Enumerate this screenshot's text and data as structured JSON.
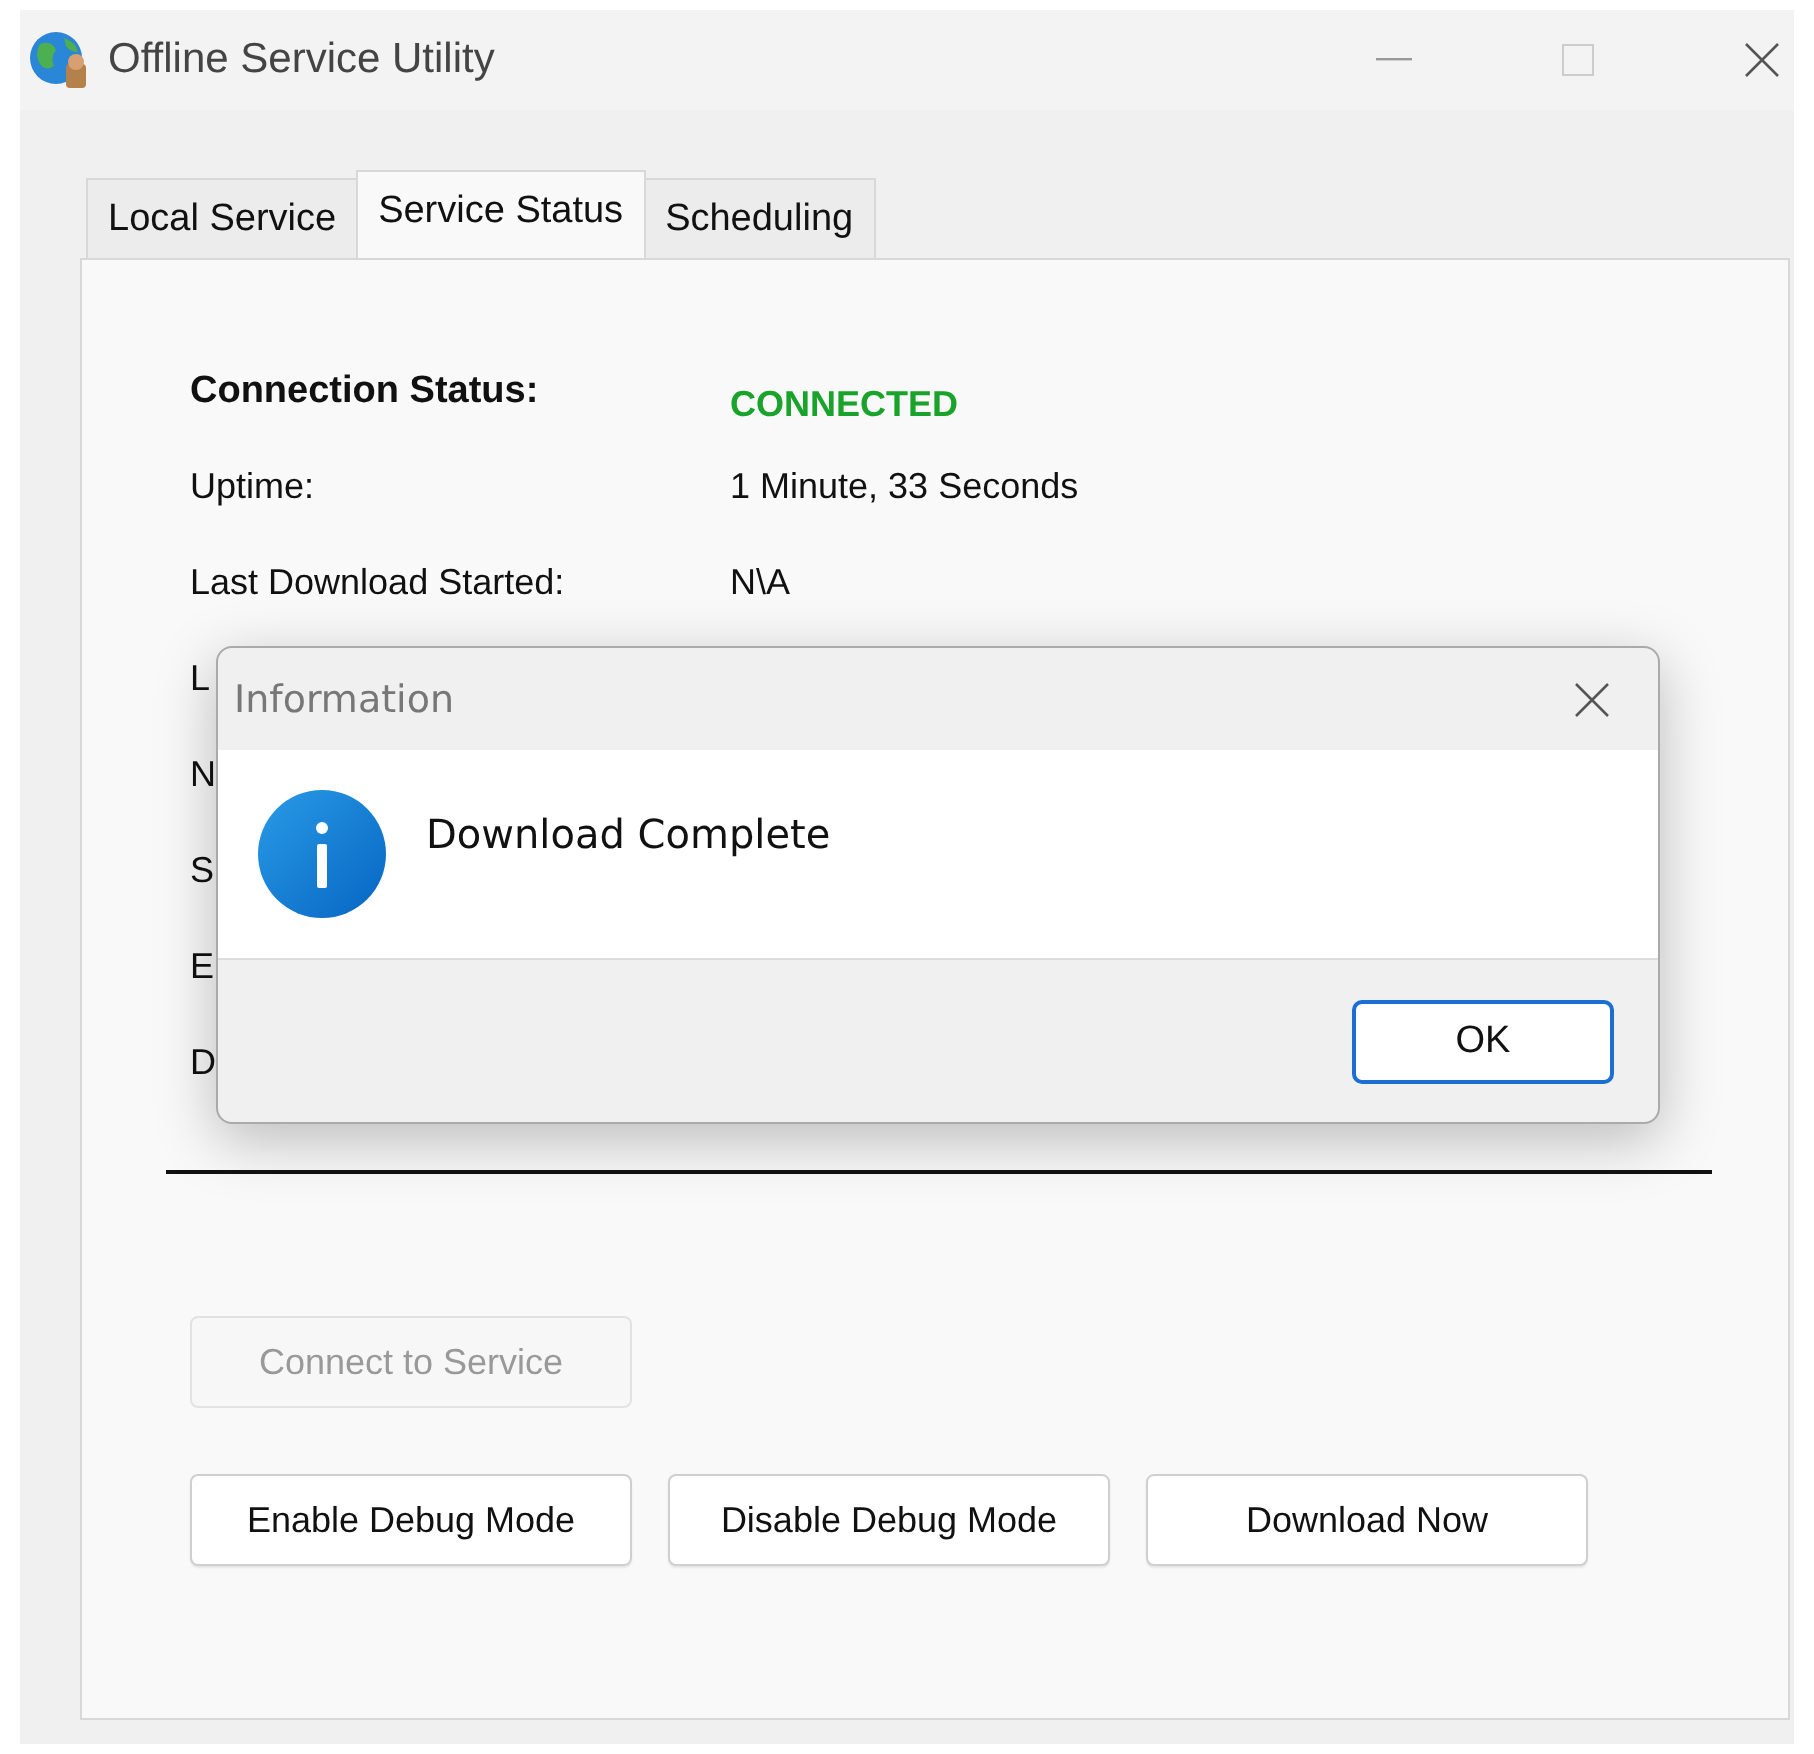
{
  "window": {
    "title": "Offline Service Utility"
  },
  "tabs": [
    {
      "label": "Local Service",
      "selected": false
    },
    {
      "label": "Service Status",
      "selected": true
    },
    {
      "label": "Scheduling",
      "selected": false
    }
  ],
  "status_rows": [
    {
      "kind": "status",
      "label": "Connection Status:",
      "value": "CONNECTED"
    },
    {
      "kind": "plain",
      "label": "Uptime:",
      "value": "1 Minute, 33 Seconds"
    },
    {
      "kind": "plain",
      "label": "Last Download Started:",
      "value": "N\\A"
    },
    {
      "kind": "plain",
      "label": "L"
    },
    {
      "kind": "plain",
      "label": "N"
    },
    {
      "kind": "plain",
      "label": "S"
    },
    {
      "kind": "plain",
      "label": "E"
    },
    {
      "kind": "plain",
      "label": "D"
    }
  ],
  "connect_button": {
    "label": "Connect to Service",
    "disabled": true
  },
  "buttons": [
    {
      "label": "Enable Debug Mode",
      "disabled": false
    },
    {
      "label": "Disable Debug Mode",
      "disabled": false
    },
    {
      "label": "Download Now",
      "disabled": false
    }
  ],
  "dialog": {
    "title": "Information",
    "message": "Download Complete",
    "button": "OK"
  }
}
